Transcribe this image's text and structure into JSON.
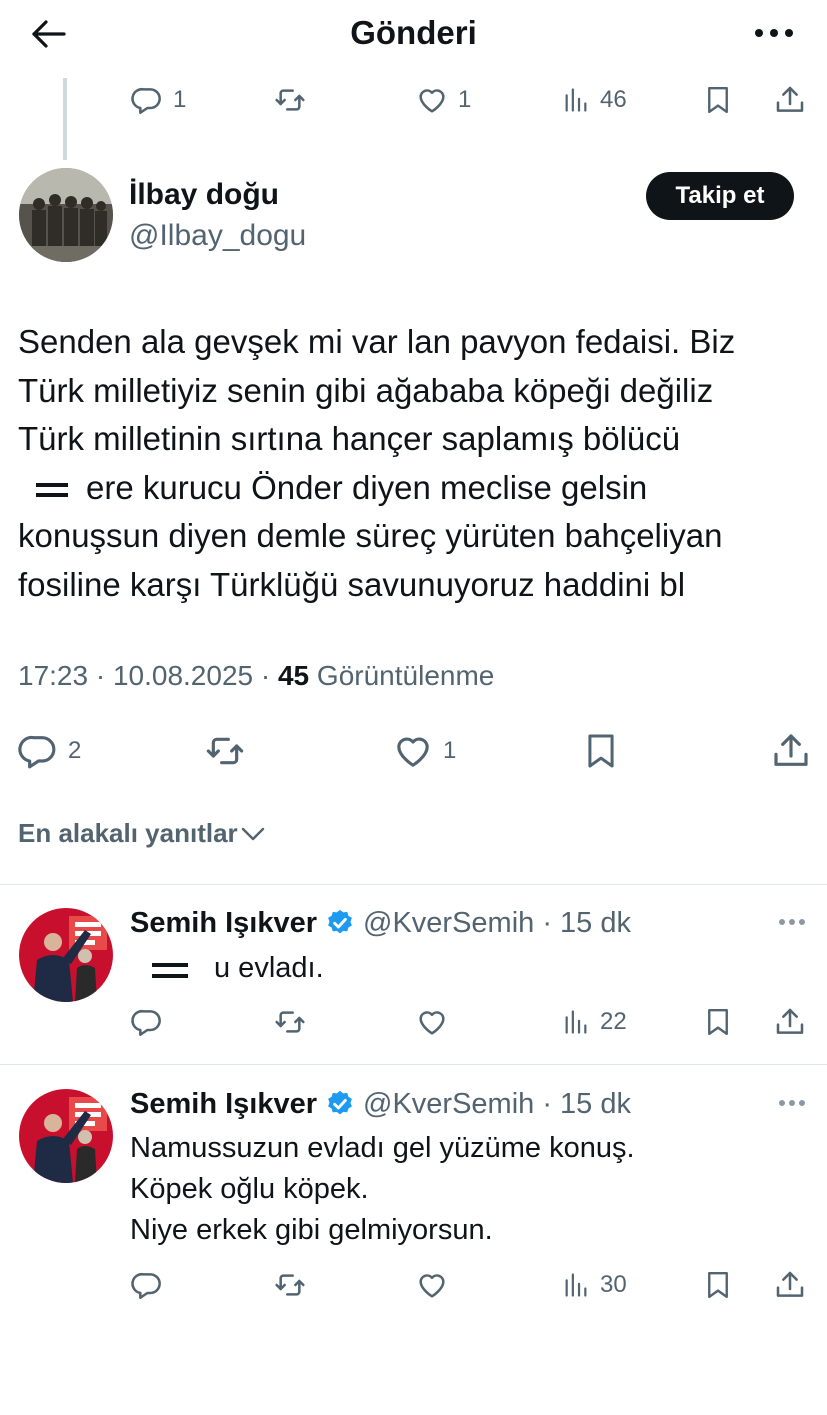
{
  "header": {
    "title": "Gönderi",
    "back_icon": "arrow-left-icon",
    "more_icon": "more-horizontal-icon"
  },
  "parent_actions": {
    "replies": "1",
    "likes": "1",
    "views": "46"
  },
  "post": {
    "author_name": "İlbay doğu",
    "author_handle": "@Ilbay_dogu",
    "follow_label": "Takip et",
    "lines": [
      "Senden ala gevşek mi var lan pavyon fedaisi. Biz",
      "Türk milletiyiz senin gibi ağababa köpeği değiliz",
      "Türk milletinin sırtına hançer saplamış bölücü",
      "ere kurucu Önder diyen meclise gelsin",
      "konuşsun diyen demle süreç yürüten bahçeliyan",
      "fosiline karşı Türklüğü savunuyoruz haddini bl"
    ],
    "time": "17:23 · 10.08.2025 · ",
    "views_count": "45",
    "views_label": " Görüntülenme",
    "actions": {
      "replies": "2",
      "likes": "1"
    }
  },
  "replies_sort": {
    "label": "En alakalı yanıtlar"
  },
  "replies": [
    {
      "author_name": "Semih Işıkver",
      "author_handle": "@KverSemih · 15 dk",
      "text_lines": [
        "u evladı."
      ],
      "views": "22"
    },
    {
      "author_name": "Semih Işıkver",
      "author_handle": "@KverSemih · 15 dk",
      "text_lines": [
        "Namussuzun evladı gel yüzüme konuş.",
        "Köpek oğlu köpek.",
        "Niye erkek gibi gelmiyorsun."
      ],
      "views": "30"
    }
  ],
  "colors": {
    "text": "#0f1419",
    "secondary": "#536471",
    "verified": "#1d9bf0",
    "follow_bg": "#0f1419"
  }
}
